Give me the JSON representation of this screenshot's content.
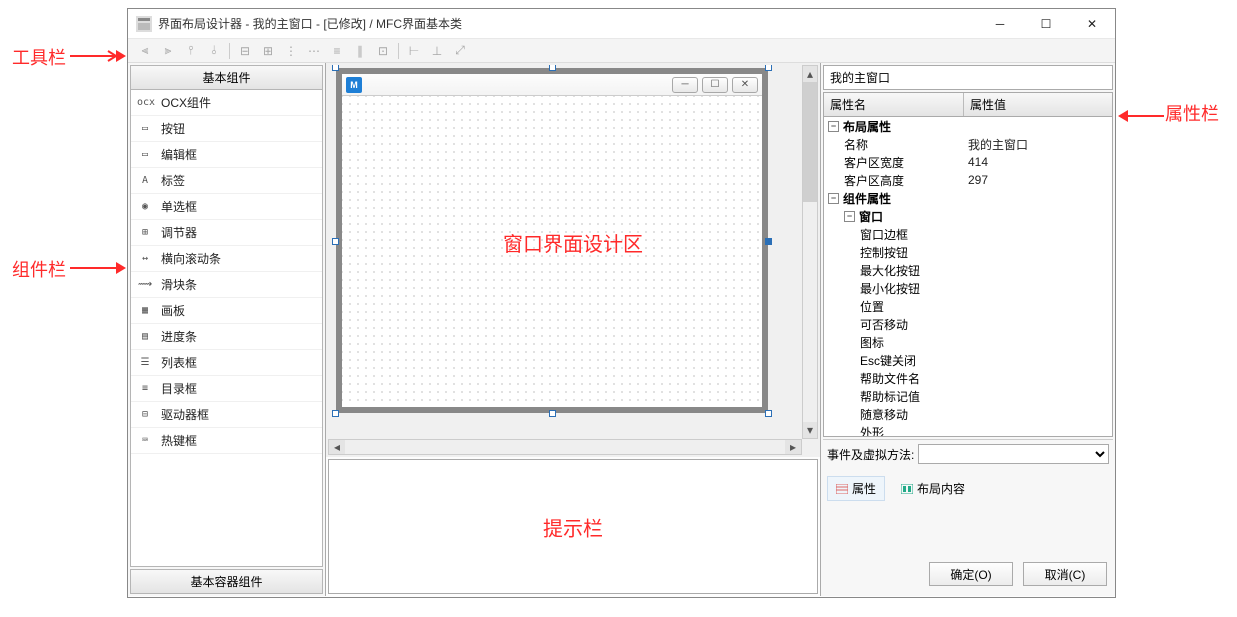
{
  "window": {
    "title": "界面布局设计器 - 我的主窗口 - [已修改] / MFC界面基本类"
  },
  "annotations": {
    "toolbar": "工具栏",
    "components": "组件栏",
    "design": "窗口界面设计区",
    "hint": "提示栏",
    "props": "属性栏"
  },
  "left": {
    "header1": "基本组件",
    "header2": "基本容器组件",
    "items": [
      {
        "icon": "ocx",
        "label": "OCX组件"
      },
      {
        "icon": "▭",
        "label": "按钮"
      },
      {
        "icon": "▭",
        "label": "编辑框"
      },
      {
        "icon": "A",
        "label": "标签"
      },
      {
        "icon": "◉",
        "label": "单选框"
      },
      {
        "icon": "⊞",
        "label": "调节器"
      },
      {
        "icon": "↔",
        "label": "横向滚动条"
      },
      {
        "icon": "⟿",
        "label": "滑块条"
      },
      {
        "icon": "▦",
        "label": "画板"
      },
      {
        "icon": "▤",
        "label": "进度条"
      },
      {
        "icon": "☰",
        "label": "列表框"
      },
      {
        "icon": "≡",
        "label": "目录框"
      },
      {
        "icon": "⊟",
        "label": "驱动器框"
      },
      {
        "icon": "⌨",
        "label": "热键框"
      }
    ]
  },
  "right": {
    "obj": "我的主窗口",
    "col1": "属性名",
    "col2": "属性值",
    "rows": [
      {
        "type": "group",
        "level": 0,
        "name": "布局属性",
        "val": ""
      },
      {
        "type": "prop",
        "level": 1,
        "name": "名称",
        "val": "我的主窗口"
      },
      {
        "type": "prop",
        "level": 1,
        "name": "客户区宽度",
        "val": "414"
      },
      {
        "type": "prop",
        "level": 1,
        "name": "客户区高度",
        "val": "297"
      },
      {
        "type": "group",
        "level": 0,
        "name": "组件属性",
        "val": ""
      },
      {
        "type": "group",
        "level": 1,
        "name": "窗口",
        "val": ""
      },
      {
        "type": "prop",
        "level": 2,
        "name": "窗口边框",
        "val": ""
      },
      {
        "type": "prop",
        "level": 2,
        "name": "控制按钮",
        "val": ""
      },
      {
        "type": "prop",
        "level": 2,
        "name": "最大化按钮",
        "val": ""
      },
      {
        "type": "prop",
        "level": 2,
        "name": "最小化按钮",
        "val": ""
      },
      {
        "type": "prop",
        "level": 2,
        "name": "位置",
        "val": ""
      },
      {
        "type": "prop",
        "level": 2,
        "name": "可否移动",
        "val": ""
      },
      {
        "type": "prop",
        "level": 2,
        "name": "图标",
        "val": ""
      },
      {
        "type": "prop",
        "level": 2,
        "name": "Esc键关闭",
        "val": ""
      },
      {
        "type": "prop",
        "level": 2,
        "name": "帮助文件名",
        "val": ""
      },
      {
        "type": "prop",
        "level": 2,
        "name": "帮助标记值",
        "val": ""
      },
      {
        "type": "prop",
        "level": 2,
        "name": "随意移动",
        "val": ""
      },
      {
        "type": "prop",
        "level": 2,
        "name": "外形",
        "val": ""
      }
    ],
    "evt_label": "事件及虚拟方法:",
    "tab1": "属性",
    "tab2": "布局内容",
    "ok": "确定(O)",
    "cancel": "取消(C)"
  }
}
